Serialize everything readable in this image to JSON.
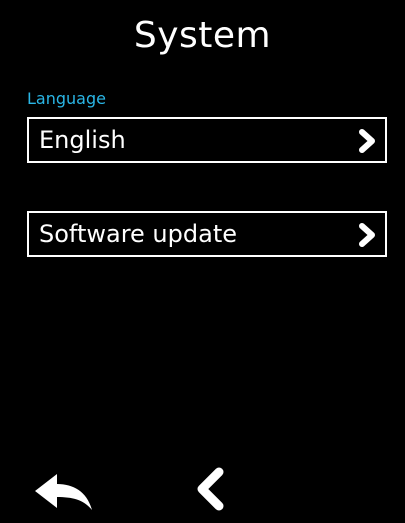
{
  "header": {
    "title": "System"
  },
  "language_section": {
    "label": "Language",
    "value": "English",
    "chevron_icon": "chevron-right-icon"
  },
  "software_section": {
    "label": "Software update",
    "chevron_icon": "chevron-right-icon"
  },
  "footer": {
    "back_icon": "back-arrow-icon",
    "prev_icon": "chevron-left-icon"
  },
  "colors": {
    "background": "#000000",
    "text": "#ffffff",
    "accent": "#2ab6e6"
  }
}
